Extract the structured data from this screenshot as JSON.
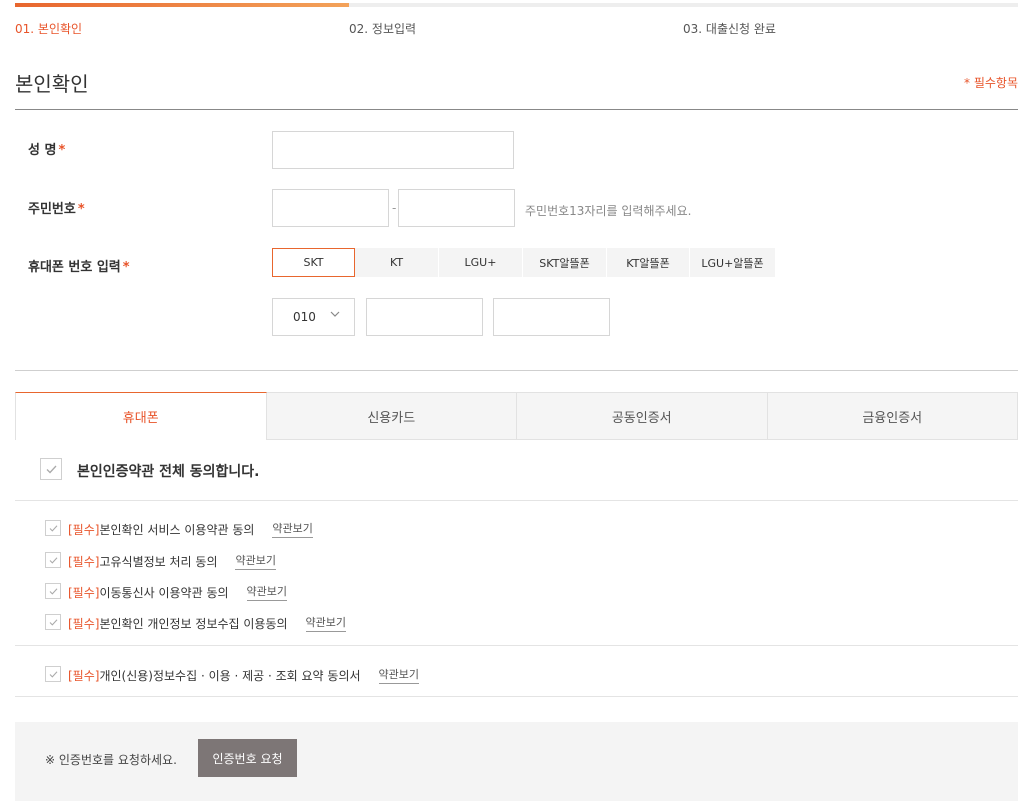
{
  "steps": [
    {
      "label": "01. 본인확인",
      "active": true
    },
    {
      "label": "02. 정보입력",
      "active": false
    },
    {
      "label": "03. 대출신청 완료",
      "active": false
    }
  ],
  "progress": {
    "fraction": 0.333
  },
  "section": {
    "title": "본인확인",
    "required_note": "* 필수항목"
  },
  "form": {
    "name_label": "성 명",
    "rrn_label": "주민번호",
    "rrn_dash": "-",
    "rrn_hint": "주민번호13자리를 입력해주세요.",
    "phone_label": "휴대폰 번호 입력",
    "star": "*",
    "name_value": "",
    "rrn_front_value": "",
    "rrn_back_value": "",
    "phone_prefix": "010",
    "phone_mid_value": "",
    "phone_last_value": ""
  },
  "carriers": [
    "SKT",
    "KT",
    "LGU+",
    "SKT알뜰폰",
    "KT알뜰폰",
    "LGU+알뜰폰"
  ],
  "selected_carrier": "SKT",
  "tabs": [
    "휴대폰",
    "신용카드",
    "공동인증서",
    "금융인증서"
  ],
  "active_tab": "휴대폰",
  "agreement": {
    "all_label": "본인인증약관 전체 동의합니다.",
    "required_tag": "[필수]",
    "view_label": "약관보기",
    "terms": [
      "본인확인 서비스 이용약관 동의",
      "고유식별정보 처리 동의",
      "이동통신사 이용약관 동의",
      "본인확인 개인정보 정보수집 이용동의",
      "개인(신용)정보수집 · 이용 · 제공 · 조회 요약 동의서"
    ]
  },
  "bottom": {
    "note": "※ 인증번호를 요청하세요.",
    "button": "인증번호 요청"
  },
  "colors": {
    "accent": "#e8542a",
    "button_bg": "#7d7676"
  },
  "icons": {
    "check": "check-icon",
    "chevron": "chevron-down-icon"
  }
}
